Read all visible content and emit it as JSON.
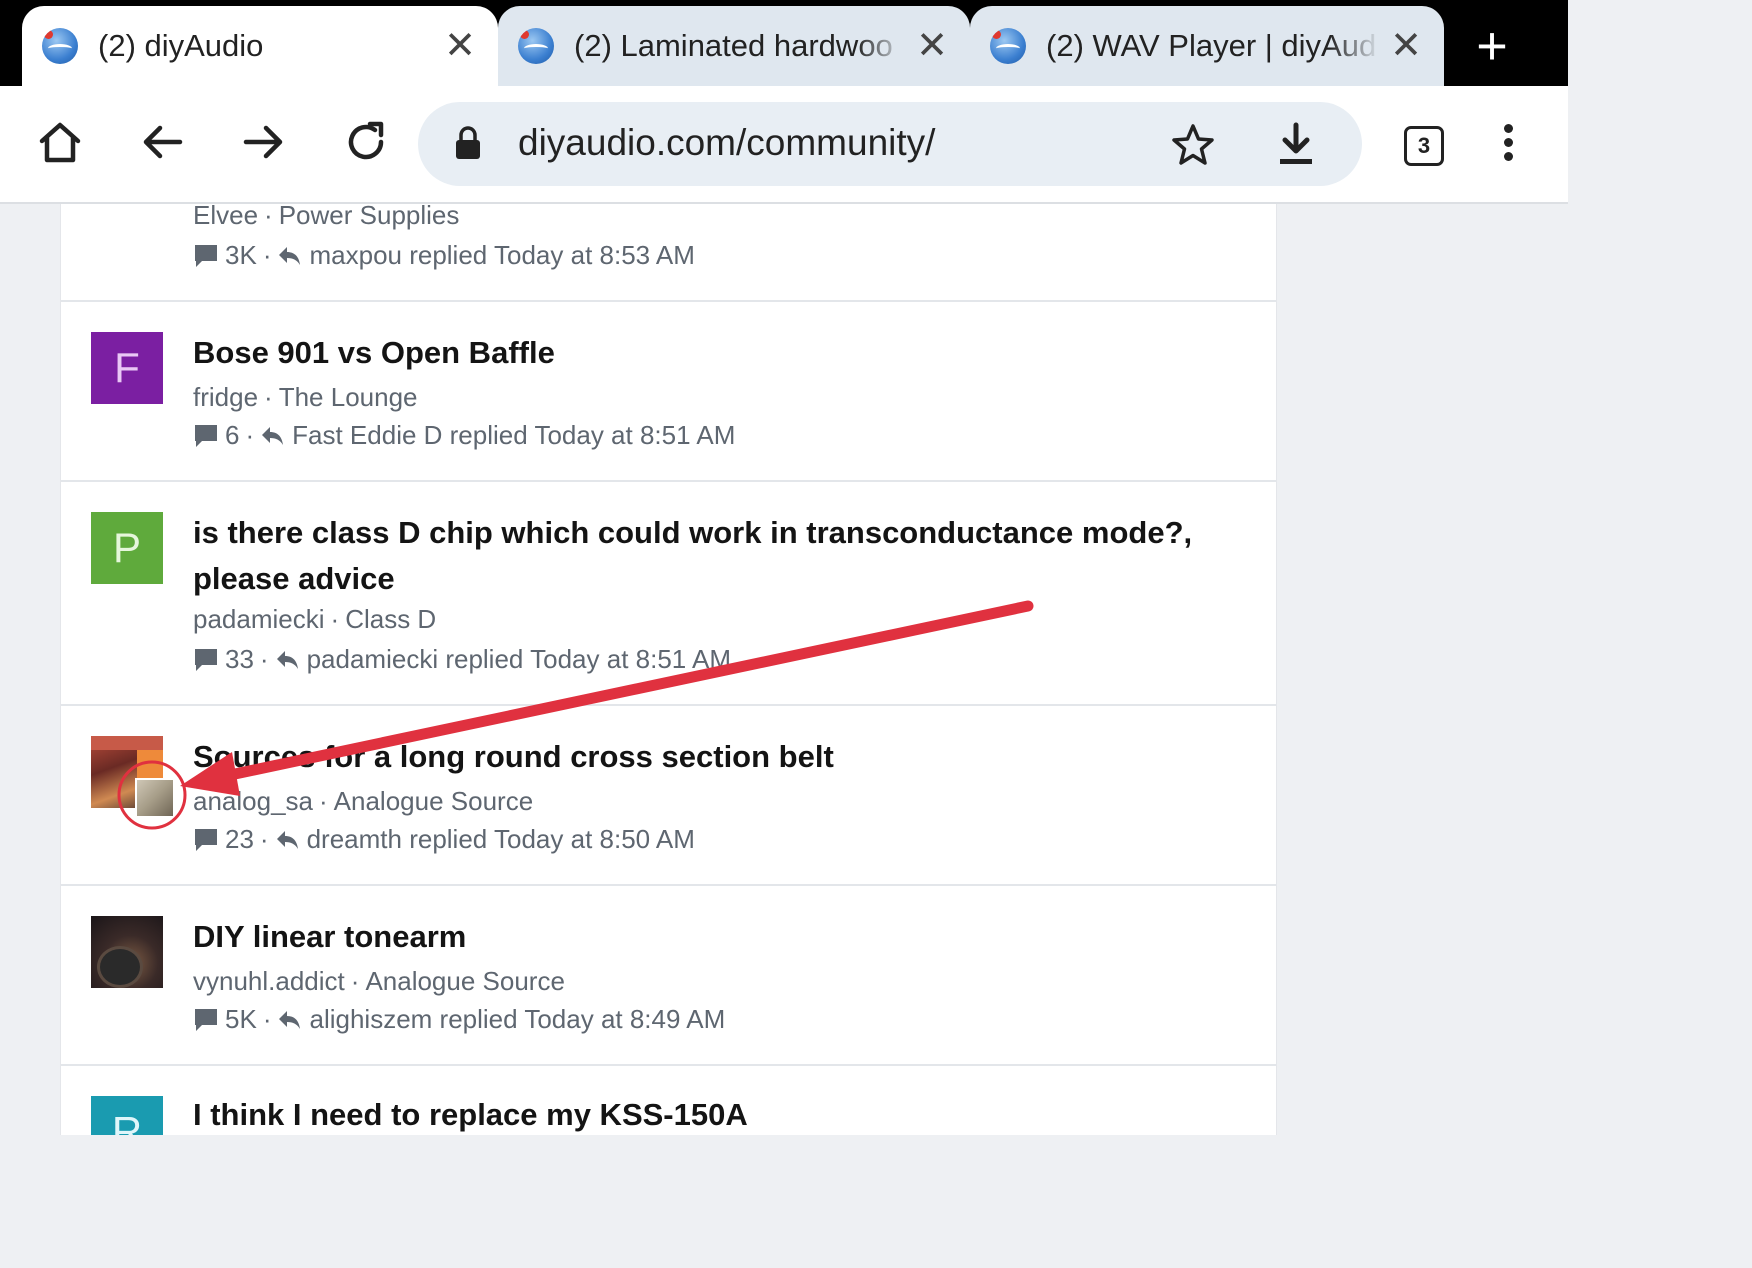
{
  "tabs": [
    {
      "title": "(2) diyAudio",
      "active": true
    },
    {
      "title": "(2) Laminated hardwoo",
      "active": false
    },
    {
      "title": "(2) WAV Player | diyAud",
      "active": false
    }
  ],
  "toolbar": {
    "url": "diyaudio.com/community/",
    "tab_count": "3"
  },
  "threads": [
    {
      "title": "",
      "author": "Elvee",
      "forum": "Power Supplies",
      "replies": "3K",
      "last_reply": "maxpou replied Today at 8:53 AM"
    },
    {
      "title": "Bose 901 vs Open Baffle",
      "avatar_letter": "F",
      "author": "fridge",
      "forum": "The Lounge",
      "replies": "6",
      "last_reply": "Fast Eddie D replied Today at 8:51 AM"
    },
    {
      "title": "is there class D chip which could work in transconductance mode?, please advice",
      "avatar_letter": "P",
      "author": "padamiecki",
      "forum": "Class D",
      "replies": "33",
      "last_reply": "padamiecki replied Today at 8:51 AM"
    },
    {
      "title": "Sources for a long round cross section belt",
      "author": "analog_sa",
      "forum": "Analogue Source",
      "replies": "23",
      "last_reply": "dreamth replied Today at 8:50 AM"
    },
    {
      "title": "DIY linear tonearm",
      "author": "vynuhl.addict",
      "forum": "Analogue Source",
      "replies": "5K",
      "last_reply": "alighiszem replied Today at 8:49 AM"
    },
    {
      "title": "I think I need to replace my KSS-150A",
      "avatar_letter": "R"
    }
  ],
  "colors": {
    "annotation": "#e0313f",
    "avatar_purple": "#7b1fa2",
    "avatar_green": "#5faa3c",
    "avatar_teal": "#1a9bb0"
  }
}
